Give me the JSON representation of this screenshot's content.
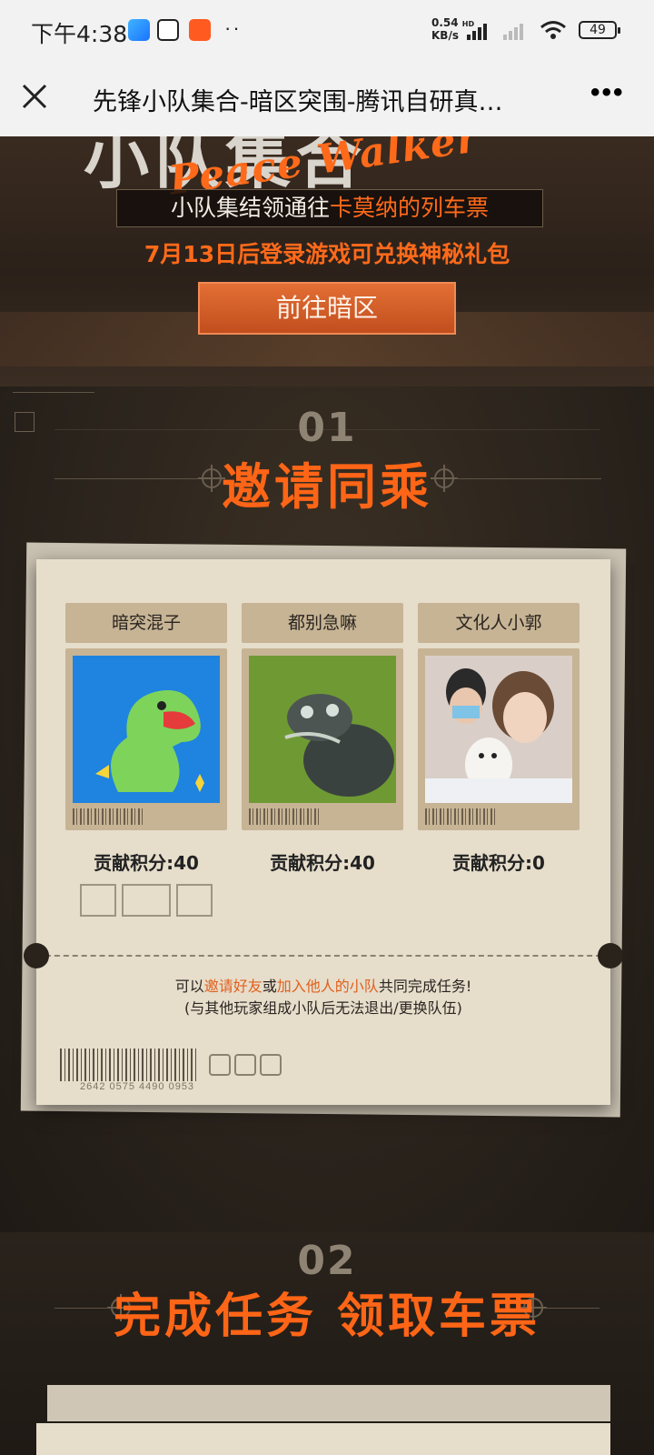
{
  "status_bar": {
    "time": "下午4:38",
    "more_dots": "··",
    "net_speed_value": "0.54",
    "net_speed_unit": "KB/s",
    "net_tag": "HD",
    "battery": "49"
  },
  "nav": {
    "title": "先锋小队集合-暗区突围-腾讯自研真…"
  },
  "hero": {
    "title_text": "小队集合",
    "script_text": "Peace Walker",
    "banner_prefix": "小队集结领通往",
    "banner_highlight": "卡莫纳的列车票",
    "sub_text": "7月13日后登录游戏可兑换神秘礼包",
    "go_button": "前往暗区"
  },
  "section1": {
    "number": "01",
    "heading": "邀请同乘",
    "members": [
      {
        "name": "暗突混子",
        "score_label": "贡献积分:",
        "score": "40"
      },
      {
        "name": "都别急嘛",
        "score_label": "贡献积分:",
        "score": "40"
      },
      {
        "name": "文化人小郭",
        "score_label": "贡献积分:",
        "score": "0"
      }
    ],
    "note": {
      "p1": "可以",
      "h1": "邀请好友",
      "p2": "或",
      "h2": "加入他人的小队",
      "p3": "共同完成任务!",
      "line2": "(与其他玩家组成小队后无法退出/更换队伍)"
    },
    "barcode_number": "2642 0575 4490 0953"
  },
  "section2": {
    "number": "02",
    "heading": "完成任务 领取车票"
  },
  "colors": {
    "accent": "#ff6516",
    "card_bg": "#e6ddcb",
    "page_bg": "#2a231c"
  }
}
